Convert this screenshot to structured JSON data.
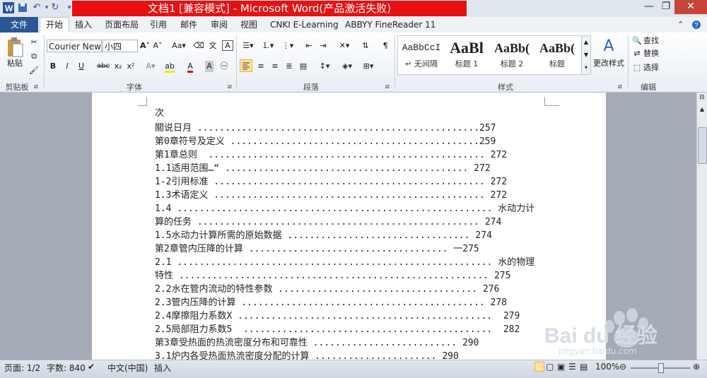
{
  "window": {
    "title": "文档1 [兼容模式] - Microsoft Word(产品激活失败)",
    "controls": [
      "—",
      "❐",
      "✕"
    ]
  },
  "menu": {
    "file": "文件",
    "tabs": [
      "开始",
      "插入",
      "页面布局",
      "引用",
      "邮件",
      "审阅",
      "视图",
      "CNKI E-Learning",
      "ABBYY FineReader 11"
    ]
  },
  "ribbon": {
    "clipboard": {
      "paste": "粘贴",
      "label": "剪贴板"
    },
    "font": {
      "name": "Courier New",
      "size": "小四",
      "label": "字体",
      "buttons": [
        "B",
        "I",
        "U",
        "abc",
        "x₂",
        "x²"
      ]
    },
    "paragraph": {
      "label": "段落"
    },
    "styles": {
      "label": "样式",
      "items": [
        {
          "sample": "AaBbCcI",
          "name": "↵ 无间隔"
        },
        {
          "sample": "AaBl",
          "name": "标题 1"
        },
        {
          "sample": "AaBb(",
          "name": "标题 2"
        },
        {
          "sample": "AaBb(",
          "name": "标题"
        }
      ],
      "change": "更改样式"
    },
    "editing": {
      "label": "编辑",
      "find": "查找",
      "replace": "替换",
      "select": "选择"
    }
  },
  "document": {
    "lines": [
      "次",
      "關说日月 ...................................................257",
      "第0章符号及定义 .............................................259",
      "第1章总则  .................................................. 272",
      "1.1适用范围…“ ............................................ 272",
      "1-2引用标准 ................................................. 272",
      "1.3术语定义 ................................................. 272",
      "1.4 ......................................................... 水动力计",
      "算的任务 ................................................... 274",
      "1.5水动力计算所需的原始数据 ................................. 274",
      "第2章管内压降的计算 .................................... 一275",
      "2.1 ......................................................... 水的物理",
      "特性 ........................................................ 275",
      "2.2水在管内流动的特性参数 .................................... 276",
      "2.3管内压降的计算 ............................................ 278",
      "2.4摩擦阻力系数X ..............................................  279",
      "2.5局部阻力系数5  .............................................  282",
      "第3章受热面的热流密度分布和可靠性 .......................... 290",
      "3.1炉内各受热面热流密度分配的计算 ...................... 290"
    ]
  },
  "status": {
    "page": "页面: 1/2",
    "words": "字数: 840",
    "lang": "中文(中国)",
    "mode": "插入",
    "zoom": "100%"
  },
  "watermark": {
    "brand": "Bai du 经验",
    "url": "jingyan.baidu.com"
  }
}
